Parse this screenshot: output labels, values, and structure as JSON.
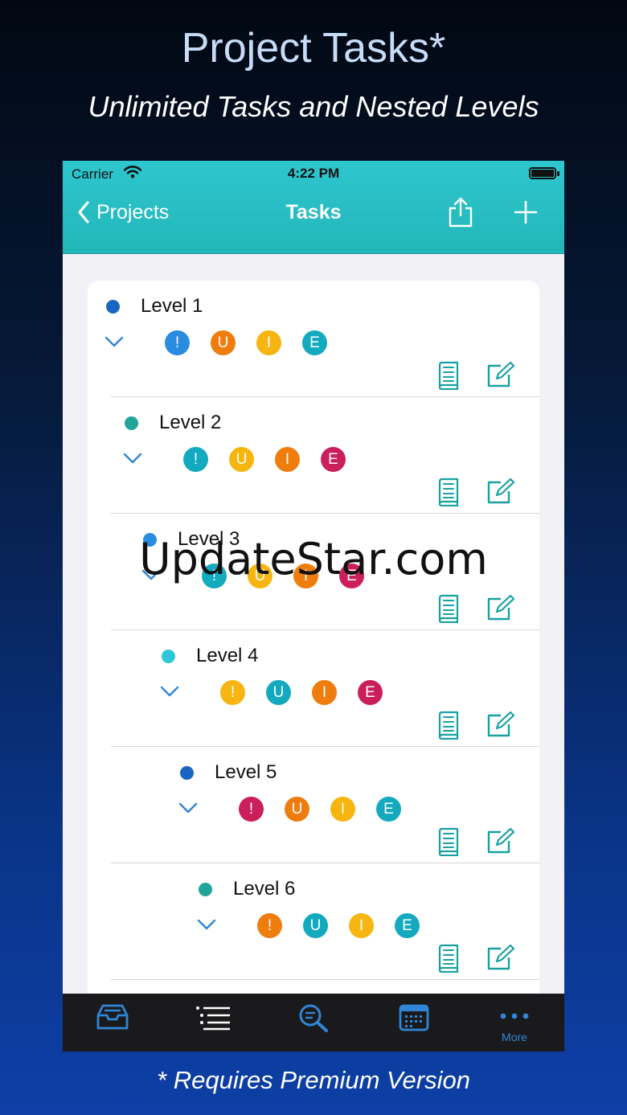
{
  "promo": {
    "title": "Project Tasks*",
    "subtitle": "Unlimited Tasks and Nested Levels",
    "footnote": "* Requires Premium Version"
  },
  "status_bar": {
    "carrier": "Carrier",
    "time": "4:22 PM"
  },
  "nav": {
    "back_label": "Projects",
    "title": "Tasks"
  },
  "tasks": [
    {
      "label": "Level 1",
      "dot_color": "#1866c2",
      "indent": 0,
      "badges": [
        {
          "text": "!",
          "color": "#2a8ce0"
        },
        {
          "text": "U",
          "color": "#ef7d0e"
        },
        {
          "text": "I",
          "color": "#f7b511"
        },
        {
          "text": "E",
          "color": "#13a9bf"
        }
      ]
    },
    {
      "label": "Level 2",
      "dot_color": "#21a49a",
      "indent": 1,
      "badges": [
        {
          "text": "!",
          "color": "#13a9bf"
        },
        {
          "text": "U",
          "color": "#f7b511"
        },
        {
          "text": "I",
          "color": "#ef7d0e"
        },
        {
          "text": "E",
          "color": "#cb1f5c"
        }
      ]
    },
    {
      "label": "Level 3",
      "dot_color": "#2a8ce0",
      "indent": 2,
      "badges": [
        {
          "text": "!",
          "color": "#13a9bf"
        },
        {
          "text": "U",
          "color": "#f7b511"
        },
        {
          "text": "I",
          "color": "#ef7d0e"
        },
        {
          "text": "E",
          "color": "#cb1f5c"
        }
      ]
    },
    {
      "label": "Level 4",
      "dot_color": "#2ec6d8",
      "indent": 3,
      "badges": [
        {
          "text": "!",
          "color": "#f7b511"
        },
        {
          "text": "U",
          "color": "#13a9bf"
        },
        {
          "text": "I",
          "color": "#ef7d0e"
        },
        {
          "text": "E",
          "color": "#cb1f5c"
        }
      ]
    },
    {
      "label": "Level 5",
      "dot_color": "#1866c2",
      "indent": 4,
      "badges": [
        {
          "text": "!",
          "color": "#cb1f5c"
        },
        {
          "text": "U",
          "color": "#ef7d0e"
        },
        {
          "text": "I",
          "color": "#f7b511"
        },
        {
          "text": "E",
          "color": "#13a9bf"
        }
      ]
    },
    {
      "label": "Level 6",
      "dot_color": "#21a49a",
      "indent": 5,
      "badges": [
        {
          "text": "!",
          "color": "#ef7d0e"
        },
        {
          "text": "U",
          "color": "#13a9bf"
        },
        {
          "text": "I",
          "color": "#f7b511"
        },
        {
          "text": "E",
          "color": "#13a9bf"
        }
      ]
    }
  ],
  "tabbar": {
    "tabs": [
      {
        "name": "inbox",
        "icon": "inbox-tray-icon"
      },
      {
        "name": "list",
        "icon": "list-icon"
      },
      {
        "name": "search",
        "icon": "search-icon"
      },
      {
        "name": "calendar",
        "icon": "calendar-icon"
      },
      {
        "name": "more",
        "icon": "more-dots-icon",
        "label": "More"
      }
    ]
  },
  "watermark": "UpdateStar.com",
  "colors": {
    "navbar": "#23b6b8",
    "accent": "#2f86d6",
    "icon_teal": "#1aa0a2"
  }
}
